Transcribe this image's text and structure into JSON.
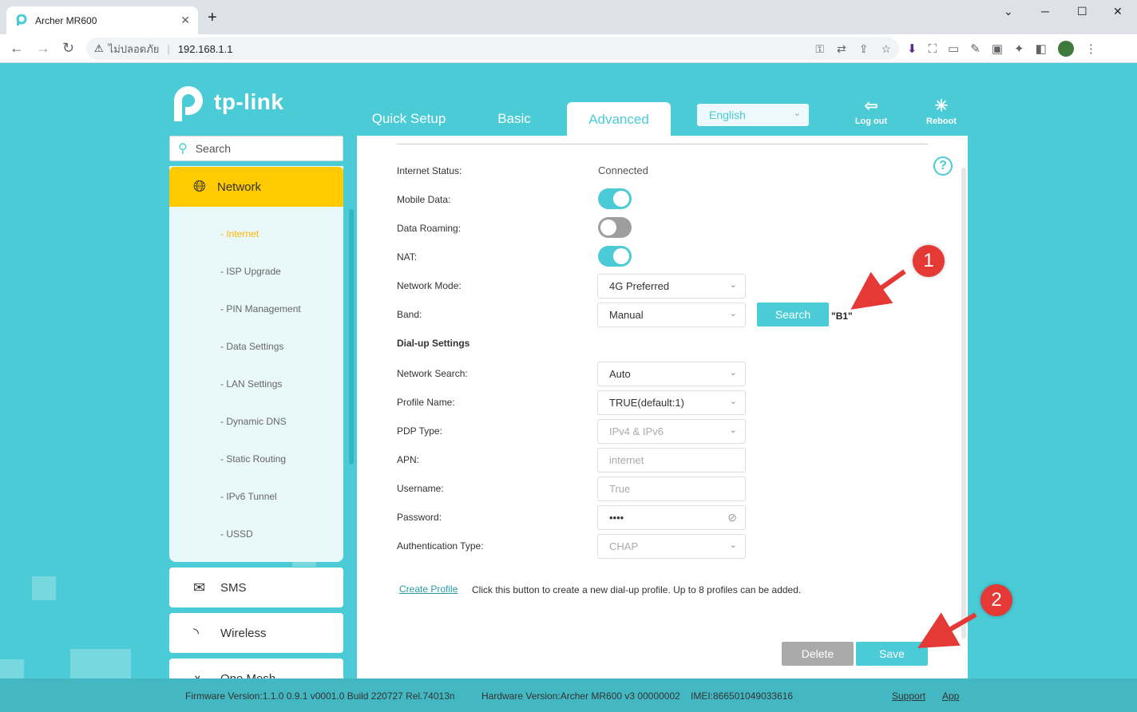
{
  "browser": {
    "tab_title": "Archer MR600",
    "tab_close": "✕",
    "new_tab": "+",
    "security_label": "ไม่ปลอดภัย",
    "url": "192.168.1.1",
    "win_min": "─",
    "win_max": "☐",
    "win_close": "✕"
  },
  "header": {
    "logo_text": "tp-link",
    "nav": [
      "Quick Setup",
      "Basic",
      "Advanced"
    ],
    "active_nav": "Advanced",
    "language": "English",
    "logout_label": "Log out",
    "reboot_label": "Reboot"
  },
  "sidebar": {
    "search_placeholder": "Search",
    "network_label": "Network",
    "sub_items": [
      "- Internet",
      "- ISP Upgrade",
      "- PIN Management",
      "- Data Settings",
      "- LAN Settings",
      "- Dynamic DNS",
      "- Static Routing",
      "- IPv6 Tunnel",
      "- USSD"
    ],
    "active_sub": "- Internet",
    "sms_label": "SMS",
    "wireless_label": "Wireless",
    "onemesh_label": "One Mesh"
  },
  "form": {
    "internet_status_label": "Internet Status:",
    "internet_status_value": "Connected",
    "mobile_data_label": "Mobile Data:",
    "mobile_data_on": true,
    "data_roaming_label": "Data Roaming:",
    "data_roaming_on": false,
    "nat_label": "NAT:",
    "nat_on": true,
    "network_mode_label": "Network Mode:",
    "network_mode_value": "4G Preferred",
    "band_label": "Band:",
    "band_value": "Manual",
    "search_button": "Search",
    "band_result": "\"B1\"",
    "dialup_section": "Dial-up Settings",
    "network_search_label": "Network Search:",
    "network_search_value": "Auto",
    "profile_name_label": "Profile Name:",
    "profile_name_value": "TRUE(default:1)",
    "pdp_type_label": "PDP Type:",
    "pdp_type_value": "IPv4 & IPv6",
    "apn_label": "APN:",
    "apn_value": "internet",
    "username_label": "Username:",
    "username_value": "True",
    "password_label": "Password:",
    "password_value": "••••",
    "auth_type_label": "Authentication Type:",
    "auth_type_value": "CHAP",
    "create_profile_link": "Create Profile",
    "create_profile_hint": "Click this button to create a new dial-up profile. Up to 8 profiles can be added.",
    "delete_button": "Delete",
    "save_button": "Save"
  },
  "footer": {
    "firmware": "Firmware Version:1.1.0 0.9.1 v0001.0 Build 220727 Rel.74013n",
    "hardware": "Hardware Version:Archer MR600 v3 00000002",
    "imei": "IMEI:866501049033616",
    "support": "Support",
    "app": "App"
  },
  "annotations": {
    "marker1": "1",
    "marker2": "2",
    "color": "#e53935"
  },
  "colors": {
    "accent": "#4acbd6",
    "network_highlight": "#ffca00"
  }
}
